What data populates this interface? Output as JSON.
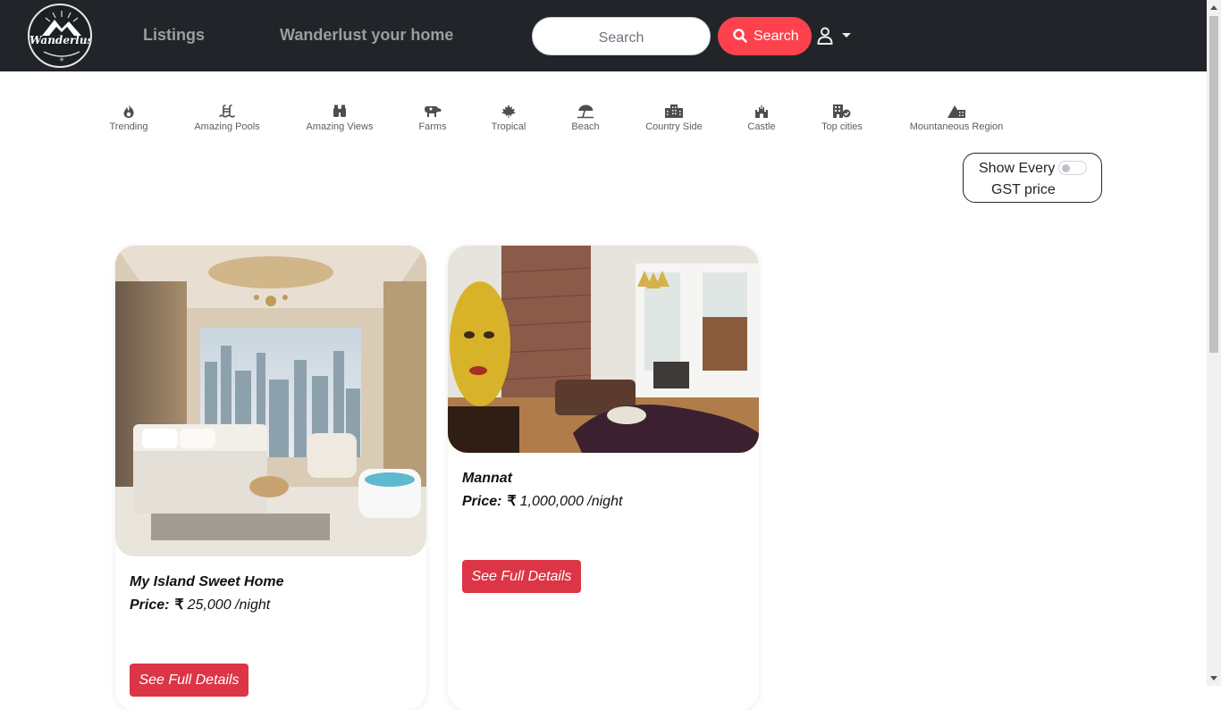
{
  "header": {
    "logo_text": "Wanderlust",
    "nav_listings": "Listings",
    "nav_home": "Wanderlust your home",
    "search_placeholder": "Search",
    "search_button": "Search"
  },
  "filters": [
    {
      "label": "Trending",
      "icon": "fire-icon"
    },
    {
      "label": "Amazing Pools",
      "icon": "pool-icon"
    },
    {
      "label": "Amazing Views",
      "icon": "binoculars-icon"
    },
    {
      "label": "Farms",
      "icon": "cow-icon"
    },
    {
      "label": "Tropical",
      "icon": "leaf-icon"
    },
    {
      "label": "Beach",
      "icon": "umbrella-beach-icon"
    },
    {
      "label": "Country Side",
      "icon": "city-icon"
    },
    {
      "label": "Castle",
      "icon": "castle-icon"
    },
    {
      "label": "Top cities",
      "icon": "building-check-icon"
    },
    {
      "label": "Mountaneous Region",
      "icon": "mountain-city-icon"
    }
  ],
  "tax_toggle": {
    "line1": "Show Every",
    "line2": "GST price",
    "enabled": false
  },
  "listings": [
    {
      "title": "My Island Sweet Home",
      "price_label": "Price:",
      "currency": "₹",
      "price": "25,000 /night",
      "button": "See Full Details"
    },
    {
      "title": "Mannat",
      "price_label": "Price:",
      "currency": "₹",
      "price": "1,000,000 /night",
      "button": "See Full Details"
    }
  ],
  "colors": {
    "navbar": "#212529",
    "accent": "#fe424d",
    "details_button": "#dc3545"
  }
}
